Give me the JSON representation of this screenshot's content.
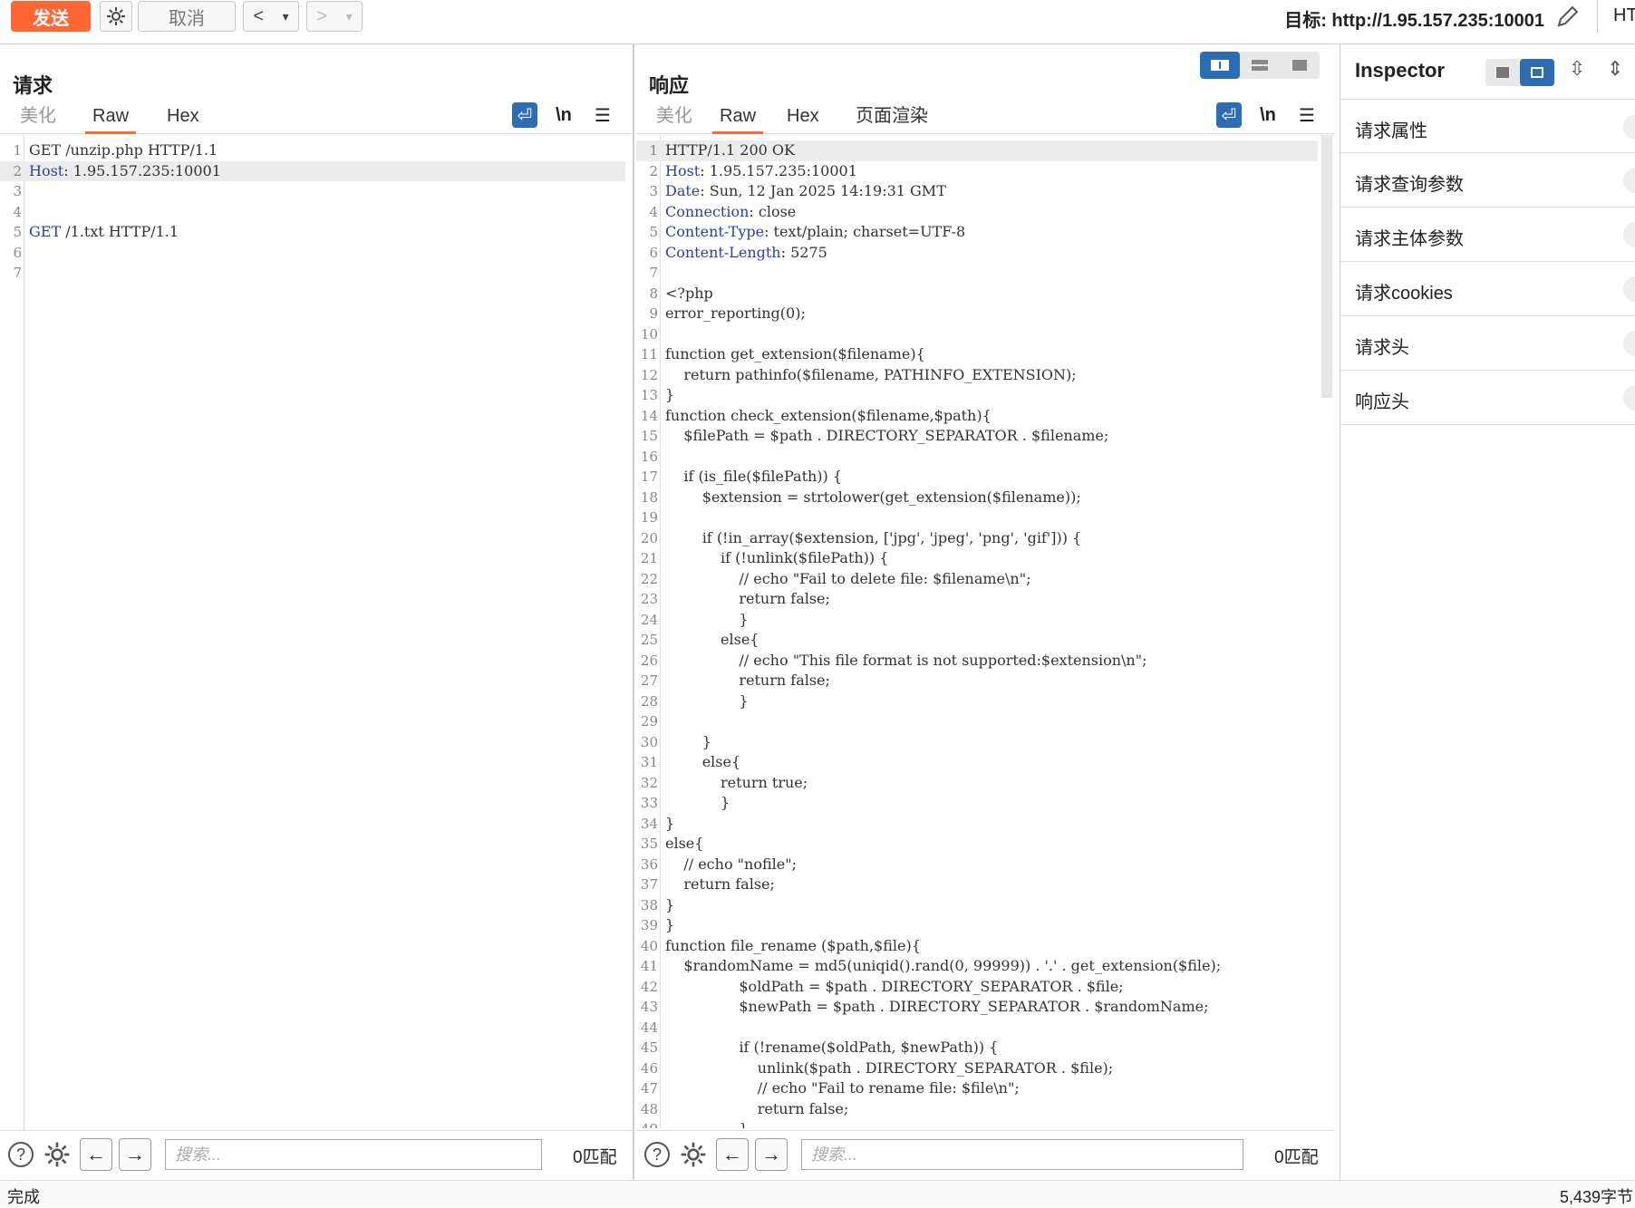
{
  "toolbar": {
    "send_label": "发送",
    "cancel_label": "取消",
    "back_label": "<",
    "back_menu": "▾",
    "forward_label": ">",
    "forward_menu": "▾",
    "target_label": "目标: http://1.95.157.235:10001",
    "http_version_label": "HT",
    "icons": {
      "settings": "gear-icon",
      "edit": "pencil-icon"
    }
  },
  "request": {
    "title": "请求",
    "tabs": [
      "美化",
      "Raw",
      "Hex"
    ],
    "active_tab": "Raw",
    "wrap_icon": "wrap-icon",
    "newline_label": "\\n",
    "menu_icon": "menu-icon",
    "lines": [
      {
        "n": "1",
        "t": "GET /unzip.php HTTP/1.1",
        "k": ""
      },
      {
        "n": "2",
        "t": ": 1.95.157.235:10001",
        "k": "Host"
      },
      {
        "n": "3",
        "t": "",
        "k": ""
      },
      {
        "n": "4",
        "t": "",
        "k": ""
      },
      {
        "n": "5",
        "t": " /1.txt HTTP/1.1",
        "k": "GET"
      },
      {
        "n": "6",
        "t": "",
        "k": ""
      },
      {
        "n": "7",
        "t": "",
        "k": ""
      }
    ],
    "search_placeholder": "搜索...",
    "match_count": "0匹配"
  },
  "response": {
    "title": "响应",
    "tabs": [
      "美化",
      "Raw",
      "Hex",
      "页面渲染"
    ],
    "active_tab": "Raw",
    "newline_label": "\\n",
    "lines": [
      {
        "n": "1",
        "t": "HTTP/1.1 200 OK",
        "k": ""
      },
      {
        "n": "2",
        "t": ": 1.95.157.235:10001",
        "k": "Host"
      },
      {
        "n": "3",
        "t": ": Sun, 12 Jan 2025 14:19:31 GMT",
        "k": "Date"
      },
      {
        "n": "4",
        "t": ": close",
        "k": "Connection"
      },
      {
        "n": "5",
        "t": ": text/plain; charset=UTF-8",
        "k": "Content-Type"
      },
      {
        "n": "6",
        "t": ": 5275",
        "k": "Content-Length"
      },
      {
        "n": "7",
        "t": "",
        "k": ""
      },
      {
        "n": "8",
        "t": "<?php",
        "k": ""
      },
      {
        "n": "9",
        "t": "error_reporting(0);",
        "k": ""
      },
      {
        "n": "10",
        "t": "",
        "k": ""
      },
      {
        "n": "11",
        "t": "function get_extension($filename){",
        "k": ""
      },
      {
        "n": "12",
        "t": "    return pathinfo($filename, PATHINFO_EXTENSION);",
        "k": ""
      },
      {
        "n": "13",
        "t": "}",
        "k": ""
      },
      {
        "n": "14",
        "t": "function check_extension($filename,$path){",
        "k": ""
      },
      {
        "n": "15",
        "t": "    $filePath = $path . DIRECTORY_SEPARATOR . $filename;",
        "k": ""
      },
      {
        "n": "16",
        "t": "",
        "k": ""
      },
      {
        "n": "17",
        "t": "    if (is_file($filePath)) {",
        "k": ""
      },
      {
        "n": "18",
        "t": "        $extension = strtolower(get_extension($filename));",
        "k": ""
      },
      {
        "n": "19",
        "t": "",
        "k": ""
      },
      {
        "n": "20",
        "t": "        if (!in_array($extension, ['jpg', 'jpeg', 'png', 'gif'])) {",
        "k": ""
      },
      {
        "n": "21",
        "t": "            if (!unlink($filePath)) {",
        "k": ""
      },
      {
        "n": "22",
        "t": "                // echo \"Fail to delete file: $filename\\n\";",
        "k": ""
      },
      {
        "n": "23",
        "t": "                return false;",
        "k": ""
      },
      {
        "n": "24",
        "t": "                }",
        "k": ""
      },
      {
        "n": "25",
        "t": "            else{",
        "k": ""
      },
      {
        "n": "26",
        "t": "                // echo \"This file format is not supported:$extension\\n\";",
        "k": ""
      },
      {
        "n": "27",
        "t": "                return false;",
        "k": ""
      },
      {
        "n": "28",
        "t": "                }",
        "k": ""
      },
      {
        "n": "29",
        "t": "",
        "k": ""
      },
      {
        "n": "30",
        "t": "        }",
        "k": ""
      },
      {
        "n": "31",
        "t": "        else{",
        "k": ""
      },
      {
        "n": "32",
        "t": "            return true;",
        "k": ""
      },
      {
        "n": "33",
        "t": "            }",
        "k": ""
      },
      {
        "n": "34",
        "t": "}",
        "k": ""
      },
      {
        "n": "35",
        "t": "else{",
        "k": ""
      },
      {
        "n": "36",
        "t": "    // echo \"nofile\";",
        "k": ""
      },
      {
        "n": "37",
        "t": "    return false;",
        "k": ""
      },
      {
        "n": "38",
        "t": "}",
        "k": ""
      },
      {
        "n": "39",
        "t": "}",
        "k": ""
      },
      {
        "n": "40",
        "t": "function file_rename ($path,$file){",
        "k": ""
      },
      {
        "n": "41",
        "t": "    $randomName = md5(uniqid().rand(0, 99999)) . '.' . get_extension($file);",
        "k": ""
      },
      {
        "n": "42",
        "t": "                $oldPath = $path . DIRECTORY_SEPARATOR . $file;",
        "k": ""
      },
      {
        "n": "43",
        "t": "                $newPath = $path . DIRECTORY_SEPARATOR . $randomName;",
        "k": ""
      },
      {
        "n": "44",
        "t": "",
        "k": ""
      },
      {
        "n": "45",
        "t": "                if (!rename($oldPath, $newPath)) {",
        "k": ""
      },
      {
        "n": "46",
        "t": "                    unlink($path . DIRECTORY_SEPARATOR . $file);",
        "k": ""
      },
      {
        "n": "47",
        "t": "                    // echo \"Fail to rename file: $file\\n\";",
        "k": ""
      },
      {
        "n": "48",
        "t": "                    return false;",
        "k": ""
      },
      {
        "n": "49",
        "t": "                }",
        "k": ""
      }
    ],
    "search_placeholder": "搜索...",
    "match_count": "0匹配"
  },
  "inspector": {
    "title": "Inspector",
    "sections": [
      "请求属性",
      "请求查询参数",
      "请求主体参数",
      "请求cookies",
      "请求头",
      "响应头"
    ]
  },
  "status": {
    "left": "完成",
    "right": "5,439字节"
  },
  "colors": {
    "accent": "#ff6633",
    "header_key": "#2f3fa0",
    "toggle_blue": "#2d6db5"
  }
}
